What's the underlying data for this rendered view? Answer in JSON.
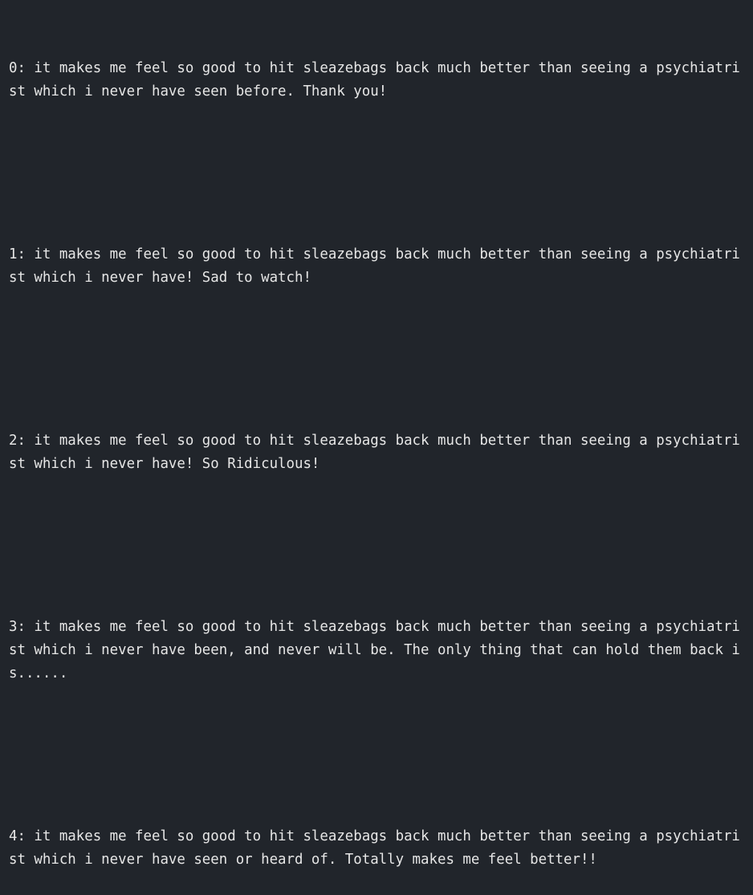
{
  "outputs": [
    {
      "text": "0: it makes me feel so good to hit sleazebags back much better than seeing a psychiatrist which i never have seen before. Thank you!"
    },
    {
      "text": "1: it makes me feel so good to hit sleazebags back much better than seeing a psychiatrist which i never have! Sad to watch!"
    },
    {
      "text": "2: it makes me feel so good to hit sleazebags back much better than seeing a psychiatrist which i never have! So Ridiculous!"
    },
    {
      "text": "3: it makes me feel so good to hit sleazebags back much better than seeing a psychiatrist which i never have been, and never will be. The only thing that can hold them back is......"
    },
    {
      "text": "4: it makes me feel so good to hit sleazebags back much better than seeing a psychiatrist which i never have seen or heard of. Totally makes me feel better!!"
    }
  ]
}
